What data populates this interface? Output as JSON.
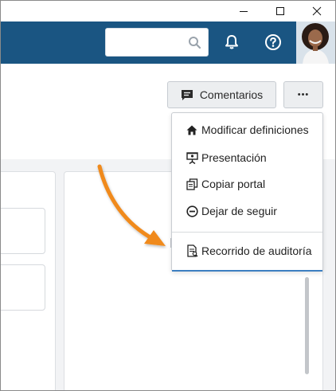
{
  "window": {
    "minimize_icon": "minimize-icon",
    "maximize_icon": "maximize-icon",
    "close_icon": "close-icon"
  },
  "header": {
    "search": {
      "value": "",
      "placeholder": ""
    },
    "icons": [
      "search-icon",
      "bell-icon",
      "help-icon"
    ],
    "brand_color": "#1a5582"
  },
  "toolbar": {
    "feedback_label": "Comentarios",
    "more_label": "•••"
  },
  "menu": {
    "items": [
      {
        "label": "Modificar definiciones",
        "icon": "home-icon"
      },
      {
        "label": "Presentación",
        "icon": "presentation-icon"
      },
      {
        "label": "Copiar portal",
        "icon": "copy-icon"
      },
      {
        "label": "Dejar de seguir",
        "icon": "unfollow-icon"
      },
      {
        "label": "Recorrido de auditoría",
        "icon": "audit-trail-icon"
      }
    ],
    "accent_color": "#3d7fc1"
  },
  "annotation": {
    "arrow_color": "#f08a1c"
  }
}
